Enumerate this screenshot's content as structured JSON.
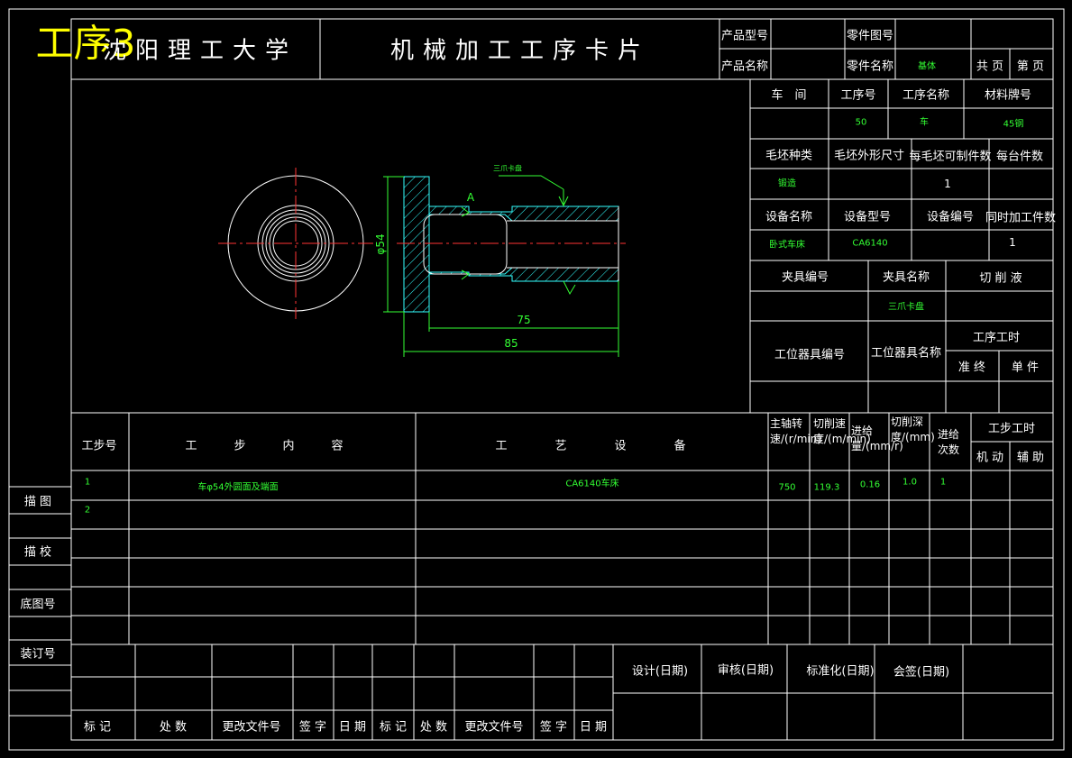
{
  "overlay_title": "工序3",
  "header": {
    "school": "沈阳理工大学",
    "card_title": "机械加工工序卡片",
    "product_model_label": "产品型号",
    "part_drawing_no_label": "零件图号",
    "product_name_label": "产品名称",
    "part_name_label": "零件名称",
    "part_name_value": "基体",
    "total_pages_label": "共 页",
    "page_no_label": "第 页"
  },
  "info": {
    "workshop_label": "车　间",
    "op_no_label": "工序号",
    "op_name_label": "工序名称",
    "material_label": "材料牌号",
    "op_no": "50",
    "op_name": "车",
    "material": "45钢",
    "blank_type_label": "毛坯种类",
    "blank_size_label": "毛坯外形尺寸",
    "per_blank_label": "每毛坯可制件数",
    "per_machine_label": "每台件数",
    "blank_type": "锻造",
    "per_blank": "1",
    "equip_name_label": "设备名称",
    "equip_model_label": "设备型号",
    "equip_no_label": "设备编号",
    "simul_label": "同时加工件数",
    "equip_name": "卧式车床",
    "equip_model": "CA6140",
    "simul": "1",
    "fixture_no_label": "夹具编号",
    "fixture_name_label": "夹具名称",
    "coolant_label": "切 削 液",
    "fixture_name": "三爪卡盘",
    "station_no_label": "工位器具编号",
    "station_name_label": "工位器具名称",
    "op_time_label": "工序工时",
    "prep_label": "准 终",
    "unit_label": "单 件"
  },
  "drawing": {
    "dia_label": "φ54",
    "len_75": "75",
    "len_85": "85",
    "note": "三爪卡盘",
    "section_mark": "A"
  },
  "steps": {
    "step_no_label": "工步号",
    "content_label": "工　步　内　容",
    "equipment_label": "工　艺　设　备",
    "spindle_label": "主轴转速/(r/min)",
    "speed_label": "切削速度/(m/min)",
    "feed_label": "进给量/(mm/r)",
    "depth_label": "切削深度/(mm)",
    "passes_label": "进给次数",
    "step_time_label": "工步工时",
    "machine_label": "机 动",
    "aux_label": "辅 助",
    "rows": [
      {
        "no": "1",
        "content": "车φ54外圆面及端面",
        "equipment": "CA6140车床",
        "spindle": "750",
        "speed": "119.3",
        "feed": "0.16",
        "depth": "1.0",
        "passes": "1"
      },
      {
        "no": "2",
        "content": "",
        "equipment": "",
        "spindle": "",
        "speed": "",
        "feed": "",
        "depth": "",
        "passes": ""
      }
    ]
  },
  "left_margin": {
    "trace": "描 图",
    "check": "描 校",
    "base_no": "底图号",
    "binding_no": "装订号"
  },
  "footer": {
    "mark": "标 记",
    "count": "处 数",
    "change_doc": "更改文件号",
    "sign": "签 字",
    "date": "日 期",
    "design": "设计(日期)",
    "review": "审核(日期)",
    "standard": "标准化(日期)",
    "countersign": "会签(日期)"
  }
}
